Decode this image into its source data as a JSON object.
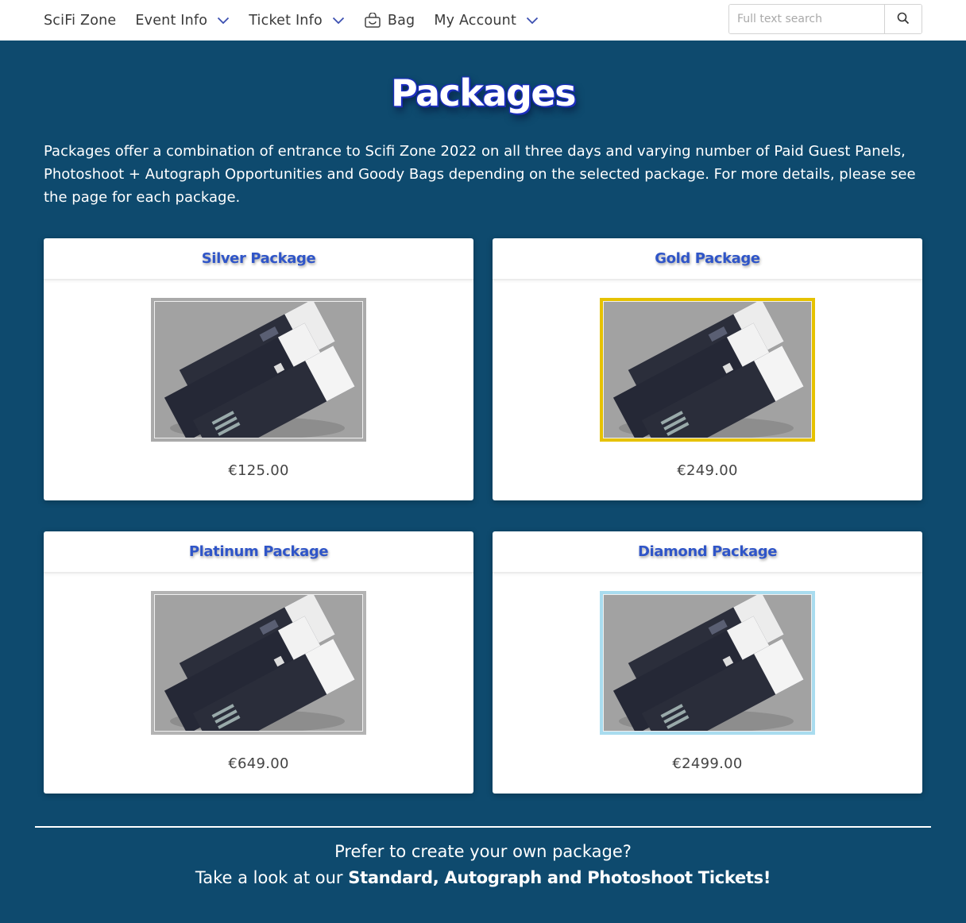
{
  "nav": {
    "brand": "SciFi Zone",
    "event_info": "Event Info",
    "ticket_info": "Ticket Info",
    "bag": "Bag",
    "my_account": "My Account",
    "search_placeholder": "Full text search"
  },
  "page": {
    "title": "Packages",
    "intro": "Packages offer a combination of entrance to Scifi Zone 2022 on all three days and varying number of Paid Guest Panels, Photoshoot + Autograph Opportunities and Goody Bags depending on the selected package. For more details, please see the page for each package."
  },
  "packages": [
    {
      "title": "Silver Package",
      "price": "€125.00",
      "border_color": "#aaaaaa"
    },
    {
      "title": "Gold Package",
      "price": "€249.00",
      "border_color": "#e6c200"
    },
    {
      "title": "Platinum Package",
      "price": "€649.00",
      "border_color": "#b3b3b3"
    },
    {
      "title": "Diamond Package",
      "price": "€2499.00",
      "border_color": "#a9dcef"
    }
  ],
  "cta": {
    "line1": "Prefer to create your own package?",
    "line2_prefix": "Take a look at our ",
    "line2_link": "Standard, Autograph and Photoshoot Tickets!"
  },
  "colors": {
    "background": "#0e4a6e",
    "card_title": "#2f55c8"
  }
}
